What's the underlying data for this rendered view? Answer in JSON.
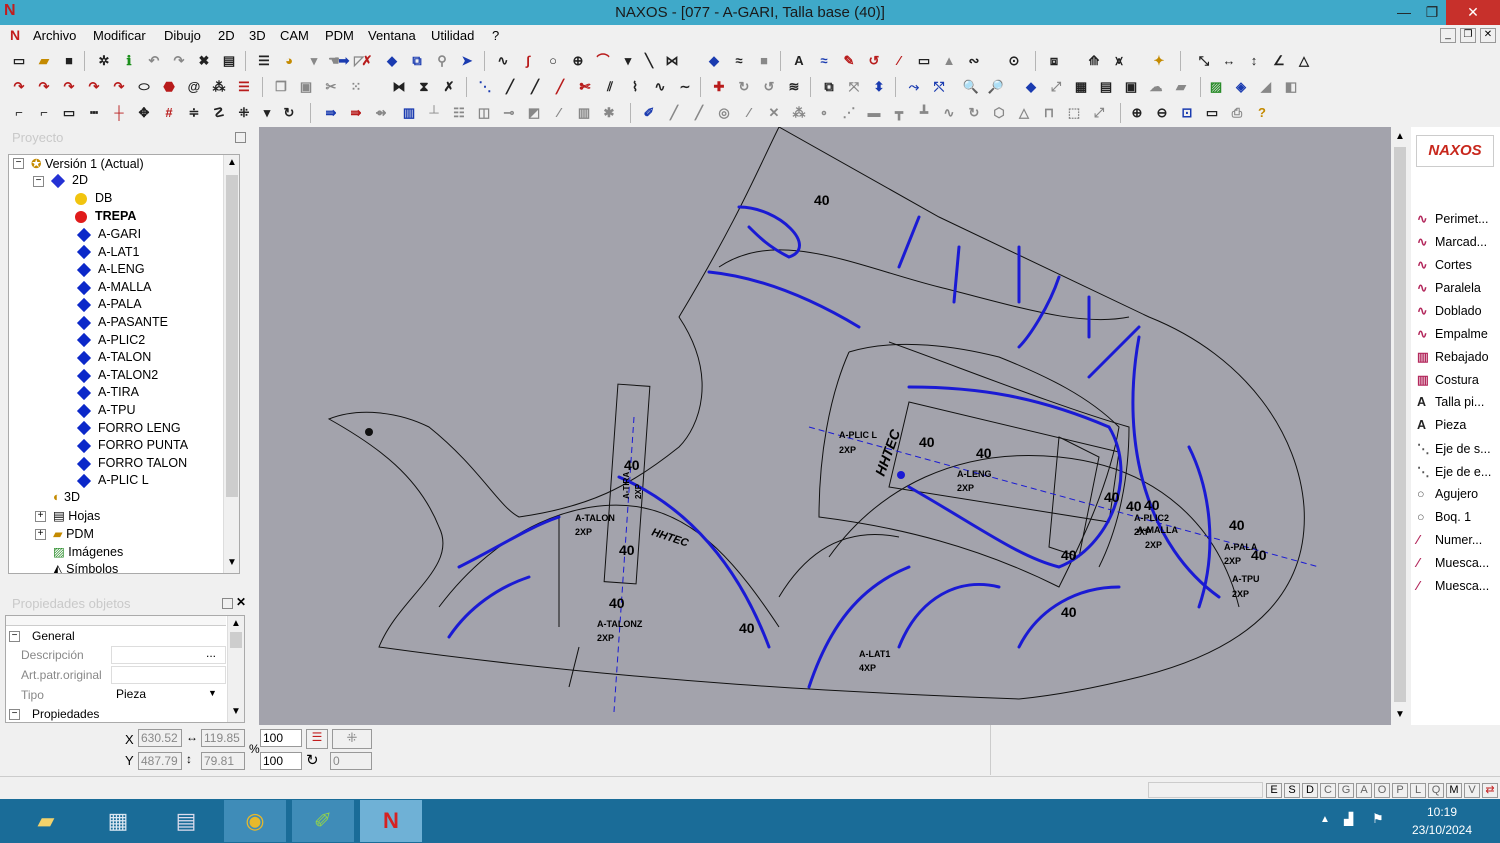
{
  "window": {
    "title": "NAXOS - [077 - A-GARI, Talla base (40)]",
    "minimize": "—",
    "maximize": "❐",
    "close": "✕",
    "logo": "N"
  },
  "menu": [
    "Archivo",
    "Modificar",
    "Dibujo",
    "2D",
    "3D",
    "CAM",
    "PDM",
    "Ventana",
    "Utilidad",
    "?"
  ],
  "project": {
    "title": "Proyecto",
    "version": "Versión 1 (Actual)",
    "node_2d": "2D",
    "db": "DB",
    "trepa": "TREPA",
    "pieces": [
      "A-GARI",
      "A-LAT1",
      "A-LENG",
      "A-MALLA",
      "A-PALA",
      "A-PASANTE",
      "A-PLIC2",
      "A-TALON",
      "A-TALON2",
      "A-TIRA",
      "A-TPU",
      "FORRO LENG",
      "FORRO PUNTA",
      "FORRO TALON",
      "A-PLIC L"
    ],
    "node_3d": "3D",
    "hojas": "Hojas",
    "pdm": "PDM",
    "imagenes": "Imágenes",
    "simbolos": "Símbolos"
  },
  "properties": {
    "title": "Propiedades objetos",
    "general": "General",
    "descripcion": "Descripción",
    "art": "Art.patr.original",
    "tipo": "Tipo",
    "tipo_value": "Pieza",
    "propiedades": "Propiedades",
    "ellipsis": "..."
  },
  "right_panel": {
    "logo": "NAXOS",
    "items": [
      "Perimet...",
      "Marcad...",
      "Cortes",
      "Paralela",
      "Doblado",
      "Empalme",
      "Rebajado",
      "Costura",
      "Talla pi...",
      "Pieza",
      "Eje de s...",
      "Eje de e...",
      "Agujero",
      "Boq. 1",
      "Numer...",
      "Muesca...",
      "Muesca..."
    ]
  },
  "coords": {
    "x_label": "X",
    "y_label": "Y",
    "x": "630.52",
    "y": "487.79",
    "w": "119.85",
    "h": "79.81",
    "pct_label": "%",
    "sx": "100",
    "sy": "100",
    "angle": "0"
  },
  "status_letters": [
    "E",
    "S",
    "D",
    "C",
    "G",
    "A",
    "O",
    "P",
    "L",
    "Q",
    "M",
    "V"
  ],
  "canvas": {
    "size_labels": [
      "40",
      "40",
      "40",
      "40",
      "40",
      "40",
      "40",
      "40",
      "40",
      "40",
      "40",
      "40",
      "40",
      "40"
    ],
    "piece_labels": [
      {
        "name": "A-PLIC L",
        "qty": "2XP"
      },
      {
        "name": "A-LENG",
        "qty": "2XP"
      },
      {
        "name": "A-TALON",
        "qty": "2XP"
      },
      {
        "name": "A-TIRA",
        "qty": "2XP"
      },
      {
        "name": "A-TALONZ",
        "qty": "2XP"
      },
      {
        "name": "A-PLIC2",
        "qty": "2XP"
      },
      {
        "name": "A-MALLA",
        "qty": "2XP"
      },
      {
        "name": "A-PALA",
        "qty": "2XP"
      },
      {
        "name": "A-TPU",
        "qty": "2XP"
      },
      {
        "name": "A-LAT1",
        "qty": "4XP"
      }
    ],
    "brand": "HHTEC"
  },
  "taskbar": {
    "time": "10:19",
    "date": "23/10/2024"
  }
}
